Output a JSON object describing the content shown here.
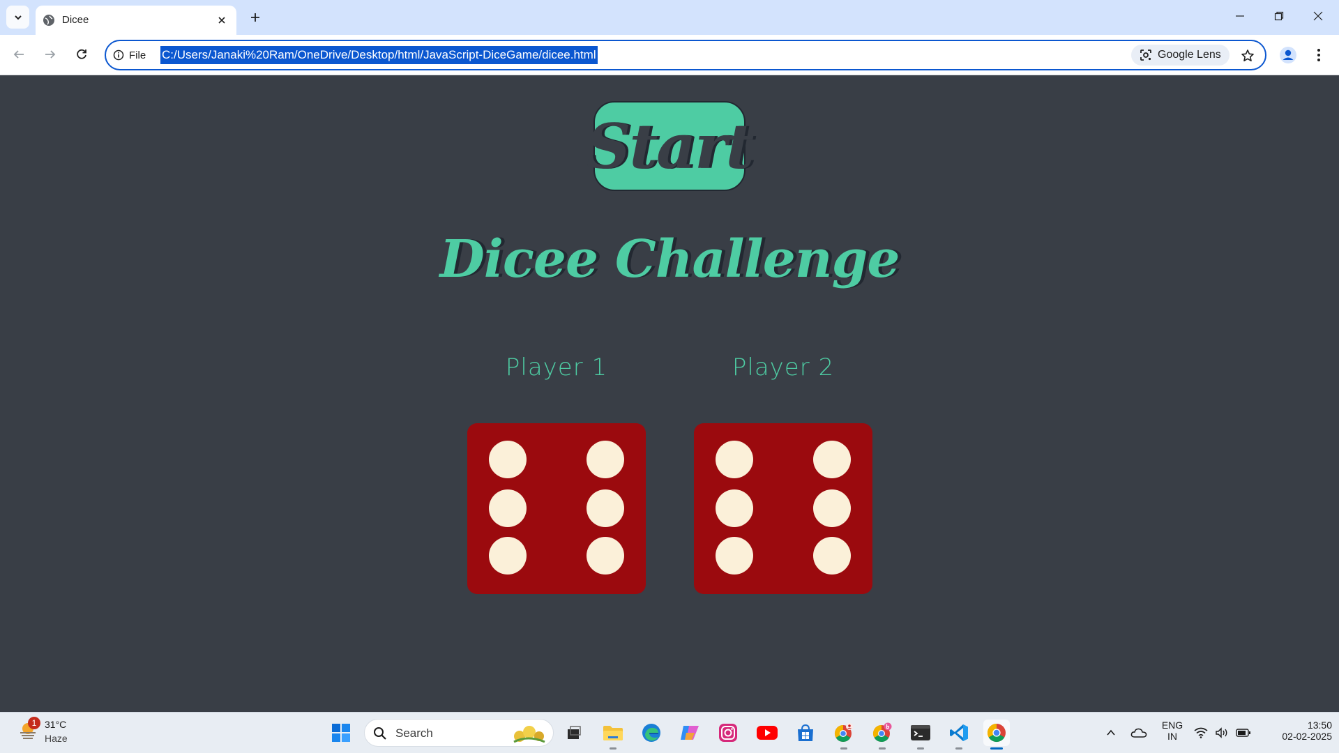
{
  "browser": {
    "tab_title": "Dicee",
    "site_chip_label": "File",
    "url": "C:/Users/Janaki%20Ram/OneDrive/Desktop/html/JavaScript-DiceGame/dicee.html",
    "lens_label": "Google Lens"
  },
  "page": {
    "start_label": "Start",
    "title": "Dicee Challenge",
    "players": [
      {
        "label": "Player 1",
        "die_value": 6
      },
      {
        "label": "Player 2",
        "die_value": 6
      }
    ],
    "colors": {
      "background": "#393e46",
      "accent": "#4ecca3",
      "die": "#9b0a0e",
      "pip": "#fbf0d9"
    }
  },
  "taskbar": {
    "weather_badge": "1",
    "weather_temp": "31°C",
    "weather_cond": "Haze",
    "search_placeholder": "Search",
    "apps": [
      "start-icon",
      "search",
      "task-view-icon",
      "file-explorer-icon",
      "edge-icon",
      "copilot-icon",
      "instagram-icon",
      "youtube-icon",
      "store-icon",
      "chrome-profile-icon",
      "chrome-profile-b-icon",
      "terminal-icon",
      "vscode-icon",
      "chrome-icon"
    ],
    "lang_line1": "ENG",
    "lang_line2": "IN",
    "time": "13:50",
    "date": "02-02-2025"
  }
}
